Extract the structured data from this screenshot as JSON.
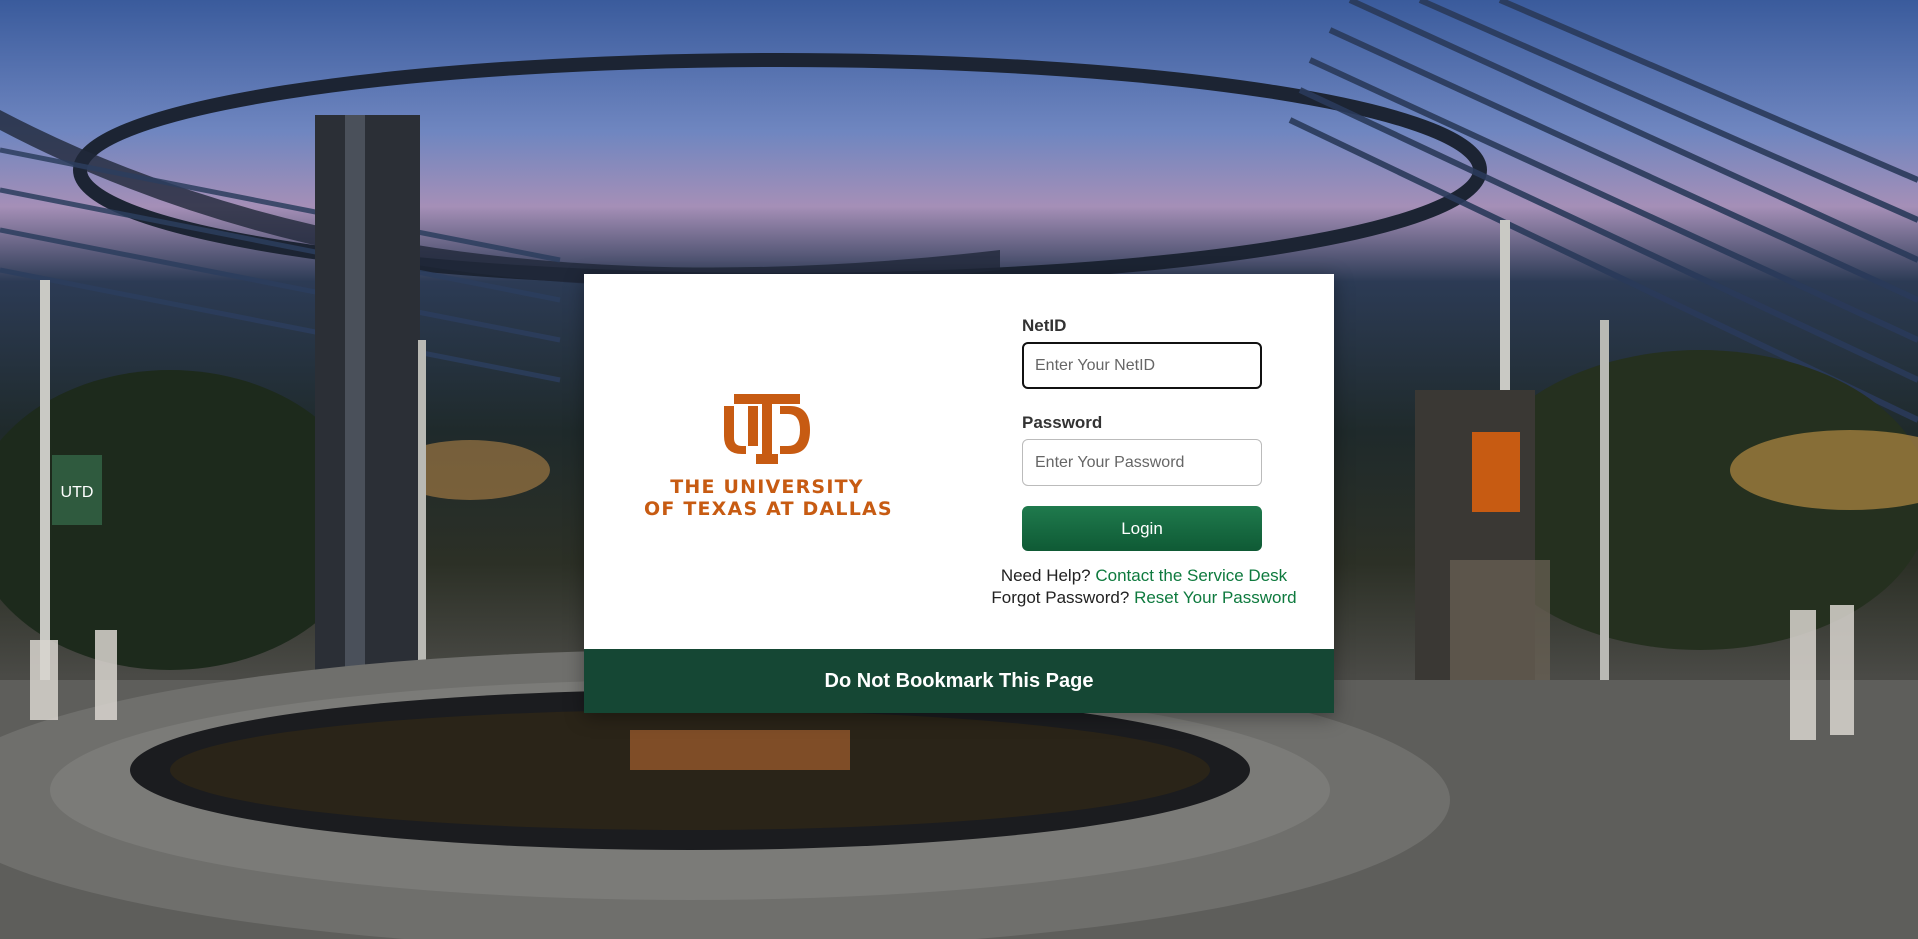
{
  "background": {
    "description_icon": "campus-plaza-photo",
    "banner_text": "UTD"
  },
  "logo": {
    "monogram": "UTD",
    "line1": "THE UNIVERSITY",
    "line2": "OF TEXAS AT DALLAS",
    "color": "#c75b12"
  },
  "form": {
    "netid_label": "NetID",
    "netid_placeholder": "Enter Your NetID",
    "netid_value": "",
    "password_label": "Password",
    "password_placeholder": "Enter Your Password",
    "password_value": "",
    "login_label": "Login"
  },
  "help": {
    "need_help_text": "Need Help?",
    "service_desk_link": "Contact the Service Desk",
    "forgot_text": "Forgot Password?",
    "reset_link": "Reset Your Password"
  },
  "banner": {
    "text": "Do Not Bookmark This Page",
    "color": "#154734"
  },
  "colors": {
    "accent_orange": "#c75b12",
    "brand_green": "#154734",
    "link_green": "#0e7a3e"
  }
}
